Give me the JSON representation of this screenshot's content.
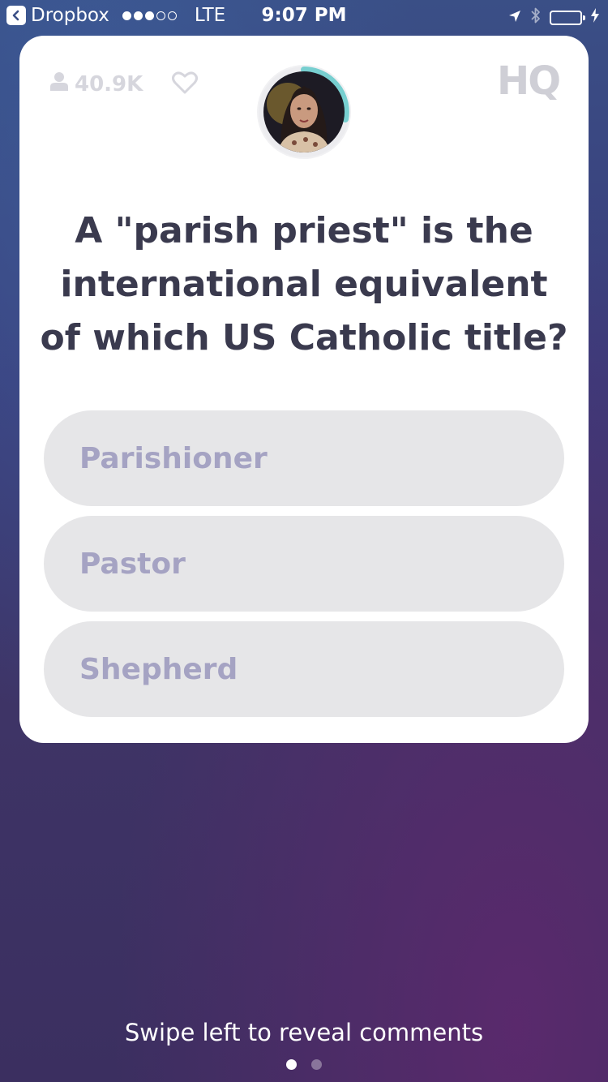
{
  "status_bar": {
    "back_app": "Dropbox",
    "carrier": "LTE",
    "time": "9:07 PM",
    "signal_bars_filled": 3,
    "signal_bars_total": 5,
    "battery_level": 1.0,
    "battery_color": "#6fd35a"
  },
  "card": {
    "viewer_count": "40.9K",
    "logo": "HQ",
    "timer_ring_color": "#77cfd0",
    "question": "A \"parish priest\" is the international equivalent of which US Catholic title?",
    "answers": [
      {
        "label": "Parishioner"
      },
      {
        "label": "Pastor"
      },
      {
        "label": "Shepherd"
      }
    ]
  },
  "footer": {
    "hint": "Swipe left to reveal comments",
    "page_count": 2,
    "current_page": 1
  },
  "icons": [
    "back-icon",
    "location-arrow-icon",
    "bluetooth-icon",
    "battery-icon",
    "charging-bolt-icon",
    "user-icon",
    "heart-icon"
  ]
}
